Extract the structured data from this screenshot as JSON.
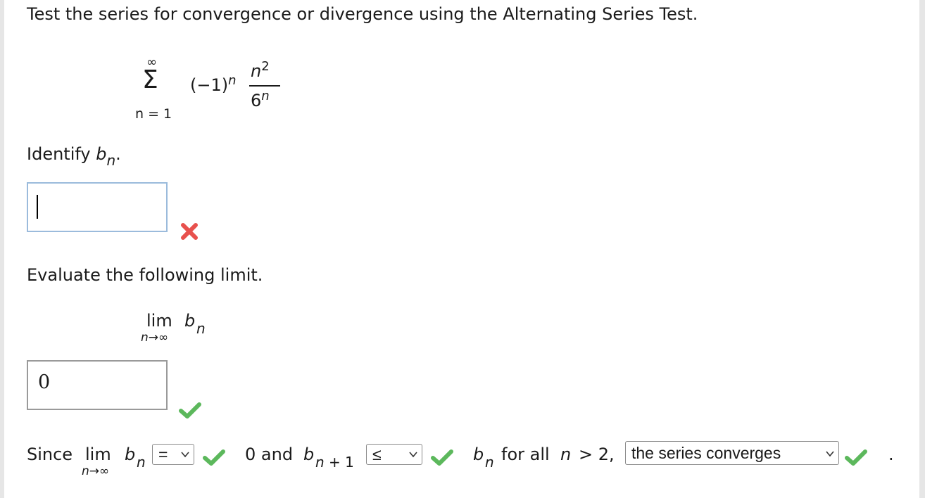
{
  "colors": {
    "error": "#e8514d",
    "success": "#5cb85c",
    "active_border": "#9bbbdc",
    "static_border": "#9a9a9a"
  },
  "question": {
    "prompt": "Test the series for convergence or divergence using the Alternating Series Test.",
    "series": {
      "upper": "∞",
      "sigma": "Σ",
      "lower": "n = 1",
      "sign_base": "(−1)",
      "sign_exp": "n",
      "num_base": "n",
      "num_exp": "2",
      "den_base": "6",
      "den_exp": "n"
    }
  },
  "part1": {
    "label": "Identify ",
    "var": "b",
    "sub": "n",
    "dot": ".",
    "answer": "",
    "status_icon": "x-icon"
  },
  "part2": {
    "label": "Evaluate the following limit.",
    "lim": "lim",
    "under": "n→∞",
    "var": "b",
    "sub": "n",
    "answer": "0",
    "status_icon": "check-icon"
  },
  "part3": {
    "since": "Since",
    "lim": "lim",
    "under": "n→∞",
    "var": "b",
    "sub": "n",
    "select1_value": "=",
    "text_and": "0 and",
    "var2": "b",
    "sub2": "n + 1",
    "select2_value": "≤",
    "var3": "b",
    "sub3": "n",
    "text_for_all": "for all",
    "var4": "n",
    "text_gt": "> 2,",
    "select3_value": "the series converges",
    "period": "."
  }
}
